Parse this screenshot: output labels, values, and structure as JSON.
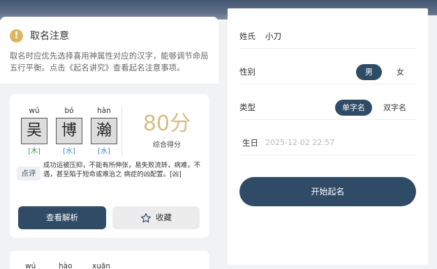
{
  "notice": {
    "icon": "warning-icon",
    "title": "取名注意",
    "text": "取名时应优先选择喜用神属性对应的汉字，能够调节命局五行平衡。点击《起名讲究》查看起名注意事项。"
  },
  "result_card": {
    "characters": [
      {
        "pinyin": "wú",
        "hanzi": "吴",
        "element": "[木]",
        "element_color": "#3f9a4f"
      },
      {
        "pinyin": "bó",
        "hanzi": "博",
        "element": "[水]",
        "element_color": "#3d86c6"
      },
      {
        "pinyin": "hàn",
        "hanzi": "瀚",
        "element": "[水]",
        "element_color": "#3d86c6"
      }
    ],
    "score": "80分",
    "score_label": "综合得分",
    "comment_tag": "点评",
    "comment_text": "成功运被压抑，不能有所伸张，易失败流转，病难，不遇，甚至陷于短命或难治之 病症的凶配置。[凶]",
    "analyze_button": "查看解析",
    "favorite_button": "收藏"
  },
  "next_card": {
    "pinyin": [
      "wú",
      "hào",
      "xuān"
    ]
  },
  "form": {
    "surname_label": "姓氏",
    "surname_value": "小刀",
    "gender_label": "性别",
    "gender_options": [
      {
        "label": "男",
        "selected": true
      },
      {
        "label": "女",
        "selected": false
      }
    ],
    "type_label": "类型",
    "type_options": [
      {
        "label": "单字名",
        "selected": true
      },
      {
        "label": "双字名",
        "selected": false
      }
    ],
    "birthday_label": "生日",
    "birthday_placeholder": "2025-12-02 22:57",
    "start_button": "开始起名"
  },
  "colors": {
    "primary": "#2f4b66",
    "score_gold": "#d5bd86",
    "warning": "#d9b564"
  }
}
